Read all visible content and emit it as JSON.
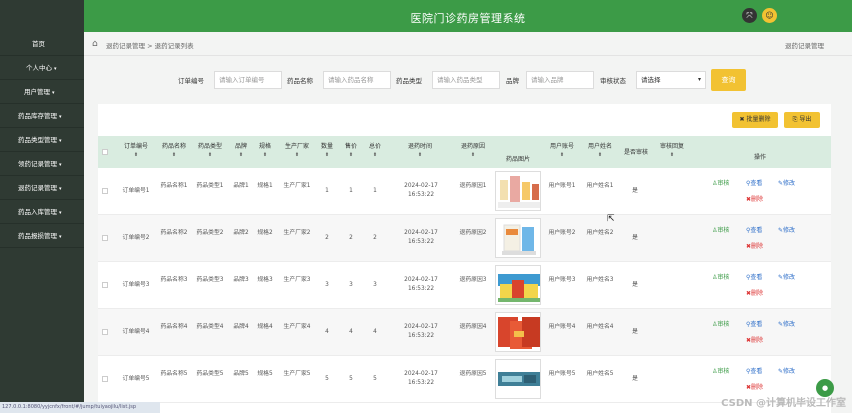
{
  "app": {
    "title": "医院门诊药房管理系统"
  },
  "sidebar": {
    "items": [
      {
        "label": "首页"
      },
      {
        "label": "个人中心"
      },
      {
        "label": "用户管理"
      },
      {
        "label": "药品库存管理"
      },
      {
        "label": "药品类型管理"
      },
      {
        "label": "领药记录管理"
      },
      {
        "label": "退药记录管理"
      },
      {
        "label": "药品入库管理"
      },
      {
        "label": "药品报损管理"
      }
    ]
  },
  "breadcrumb": {
    "path": "退药记录管理 > 退药记录列表",
    "right": "退药记录管理"
  },
  "search": {
    "order_label": "订单编号",
    "order_placeholder": "请输入订单编号",
    "name_label": "药品名称",
    "name_placeholder": "请输入药品名称",
    "type_label": "药品类型",
    "type_placeholder": "请输入药品类型",
    "brand_label": "品牌",
    "brand_placeholder": "请输入品牌",
    "status_label": "审核状态",
    "status_value": "请选择",
    "query_button": "查询"
  },
  "toolbar": {
    "batch_delete": "批量删除",
    "export": "导出"
  },
  "table": {
    "headers": {
      "order": "订单编号",
      "name": "药品名称",
      "type": "药品类型",
      "brand": "品牌",
      "spec": "规格",
      "maker": "生产厂家",
      "qty": "数量",
      "price": "售价",
      "total": "总价",
      "time": "退药时间",
      "reason": "退药原因",
      "image": "药品图片",
      "account": "用户账号",
      "uname": "用户姓名",
      "audited": "是否审核",
      "reply": "审核回复",
      "ops": "操作"
    },
    "rows": [
      {
        "order": "订单编号1",
        "name": "药品名称1",
        "type": "药品类型1",
        "brand": "品牌1",
        "spec": "规格1",
        "maker": "生产厂家1",
        "qty": "1",
        "price": "1",
        "total": "1",
        "date": "2024-02-17",
        "clock": "16:53:22",
        "reason": "退药原因1",
        "account": "用户账号1",
        "uname": "用户姓名1",
        "audited": "是"
      },
      {
        "order": "订单编号2",
        "name": "药品名称2",
        "type": "药品类型2",
        "brand": "品牌2",
        "spec": "规格2",
        "maker": "生产厂家2",
        "qty": "2",
        "price": "2",
        "total": "2",
        "date": "2024-02-17",
        "clock": "16:53:22",
        "reason": "退药原因2",
        "account": "用户账号2",
        "uname": "用户姓名2",
        "audited": "是"
      },
      {
        "order": "订单编号3",
        "name": "药品名称3",
        "type": "药品类型3",
        "brand": "品牌3",
        "spec": "规格3",
        "maker": "生产厂家3",
        "qty": "3",
        "price": "3",
        "total": "3",
        "date": "2024-02-17",
        "clock": "16:53:22",
        "reason": "退药原因3",
        "account": "用户账号3",
        "uname": "用户姓名3",
        "audited": "是"
      },
      {
        "order": "订单编号4",
        "name": "药品名称4",
        "type": "药品类型4",
        "brand": "品牌4",
        "spec": "规格4",
        "maker": "生产厂家4",
        "qty": "4",
        "price": "4",
        "total": "4",
        "date": "2024-02-17",
        "clock": "16:53:22",
        "reason": "退药原因4",
        "account": "用户账号4",
        "uname": "用户姓名4",
        "audited": "是"
      },
      {
        "order": "订单编号5",
        "name": "药品名称5",
        "type": "药品类型5",
        "brand": "品牌5",
        "spec": "规格5",
        "maker": "生产厂家5",
        "qty": "5",
        "price": "5",
        "total": "5",
        "date": "2024-02-17",
        "clock": "16:53:22",
        "reason": "退药原因5",
        "account": "用户账号5",
        "uname": "用户姓名5",
        "audited": "是"
      }
    ],
    "actions": {
      "audit": "审核",
      "view": "查看",
      "edit": "修改",
      "delete": "删除"
    }
  },
  "statusbar": {
    "url": "127.0.0.1:8080/yyjcnfx/front/#/jump/tuiyaojilu/list.jsp"
  },
  "watermark": "CSDN @计算机毕设工作室",
  "colors": {
    "header": "#3c9b47",
    "sidebar": "#2f3a33",
    "accent": "#f2c232",
    "table_head": "#d9ece0"
  }
}
